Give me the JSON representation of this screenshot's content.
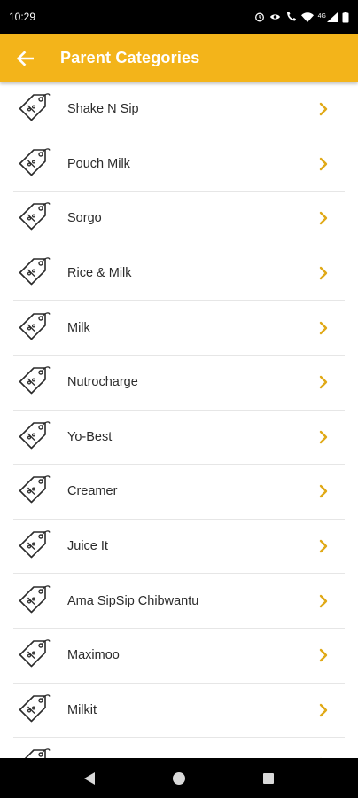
{
  "status_bar": {
    "time": "10:29",
    "network_label": "4G",
    "icons": [
      "alarm-icon",
      "eye-icon",
      "wifi-calling-icon",
      "wifi-icon",
      "signal-icon",
      "battery-icon"
    ]
  },
  "app_bar": {
    "title": "Parent Categories",
    "back_icon": "arrow-left-icon",
    "color": "#f3b41a"
  },
  "categories": [
    {
      "label": "Shake N Sip"
    },
    {
      "label": "Pouch Milk"
    },
    {
      "label": "Sorgo"
    },
    {
      "label": "Rice & Milk"
    },
    {
      "label": "Milk"
    },
    {
      "label": "Nutrocharge"
    },
    {
      "label": "Yo-Best"
    },
    {
      "label": "Creamer"
    },
    {
      "label": "Juice It"
    },
    {
      "label": "Ama SipSip Chibwantu"
    },
    {
      "label": "Maximoo"
    },
    {
      "label": "Milkit"
    },
    {
      "label": ""
    }
  ],
  "nav_bar": {
    "icons": [
      "back-triangle-icon",
      "home-circle-icon",
      "recents-square-icon"
    ]
  },
  "colors": {
    "accent": "#f3b41a",
    "chevron": "#e0a917",
    "divider": "#e6e6e6"
  }
}
